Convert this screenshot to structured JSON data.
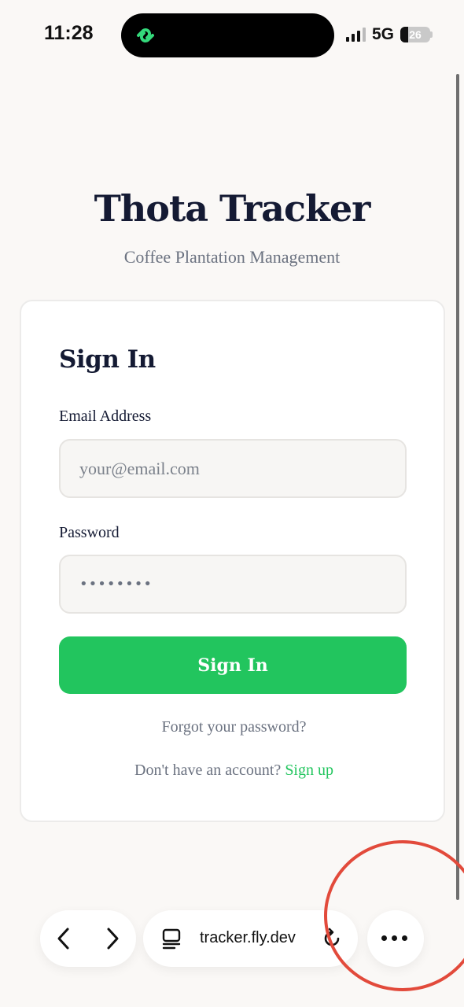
{
  "status_bar": {
    "time": "11:28",
    "network": "5G",
    "battery": "26",
    "battery_level": 0.26
  },
  "app": {
    "title": "Thota Tracker",
    "subtitle": "Coffee Plantation Management"
  },
  "sign_in": {
    "heading": "Sign In",
    "email_label": "Email Address",
    "email_placeholder": "your@email.com",
    "password_label": "Password",
    "password_value": "••••••••",
    "submit_label": "Sign In",
    "forgot_label": "Forgot your password?",
    "signup_prompt": "Don't have an account?",
    "signup_link": "Sign up"
  },
  "browser": {
    "url": "tracker.fly.dev",
    "back_icon": "chevron-left-icon",
    "forward_icon": "chevron-right-icon",
    "tabs_icon": "tabs-icon",
    "reload_icon": "reload-icon",
    "more_icon": "more-dots-icon"
  },
  "colors": {
    "accent": "#22c55e",
    "title": "#141a33",
    "muted": "#6b7280",
    "background": "#faf8f6",
    "annotation": "#e24a3b"
  }
}
